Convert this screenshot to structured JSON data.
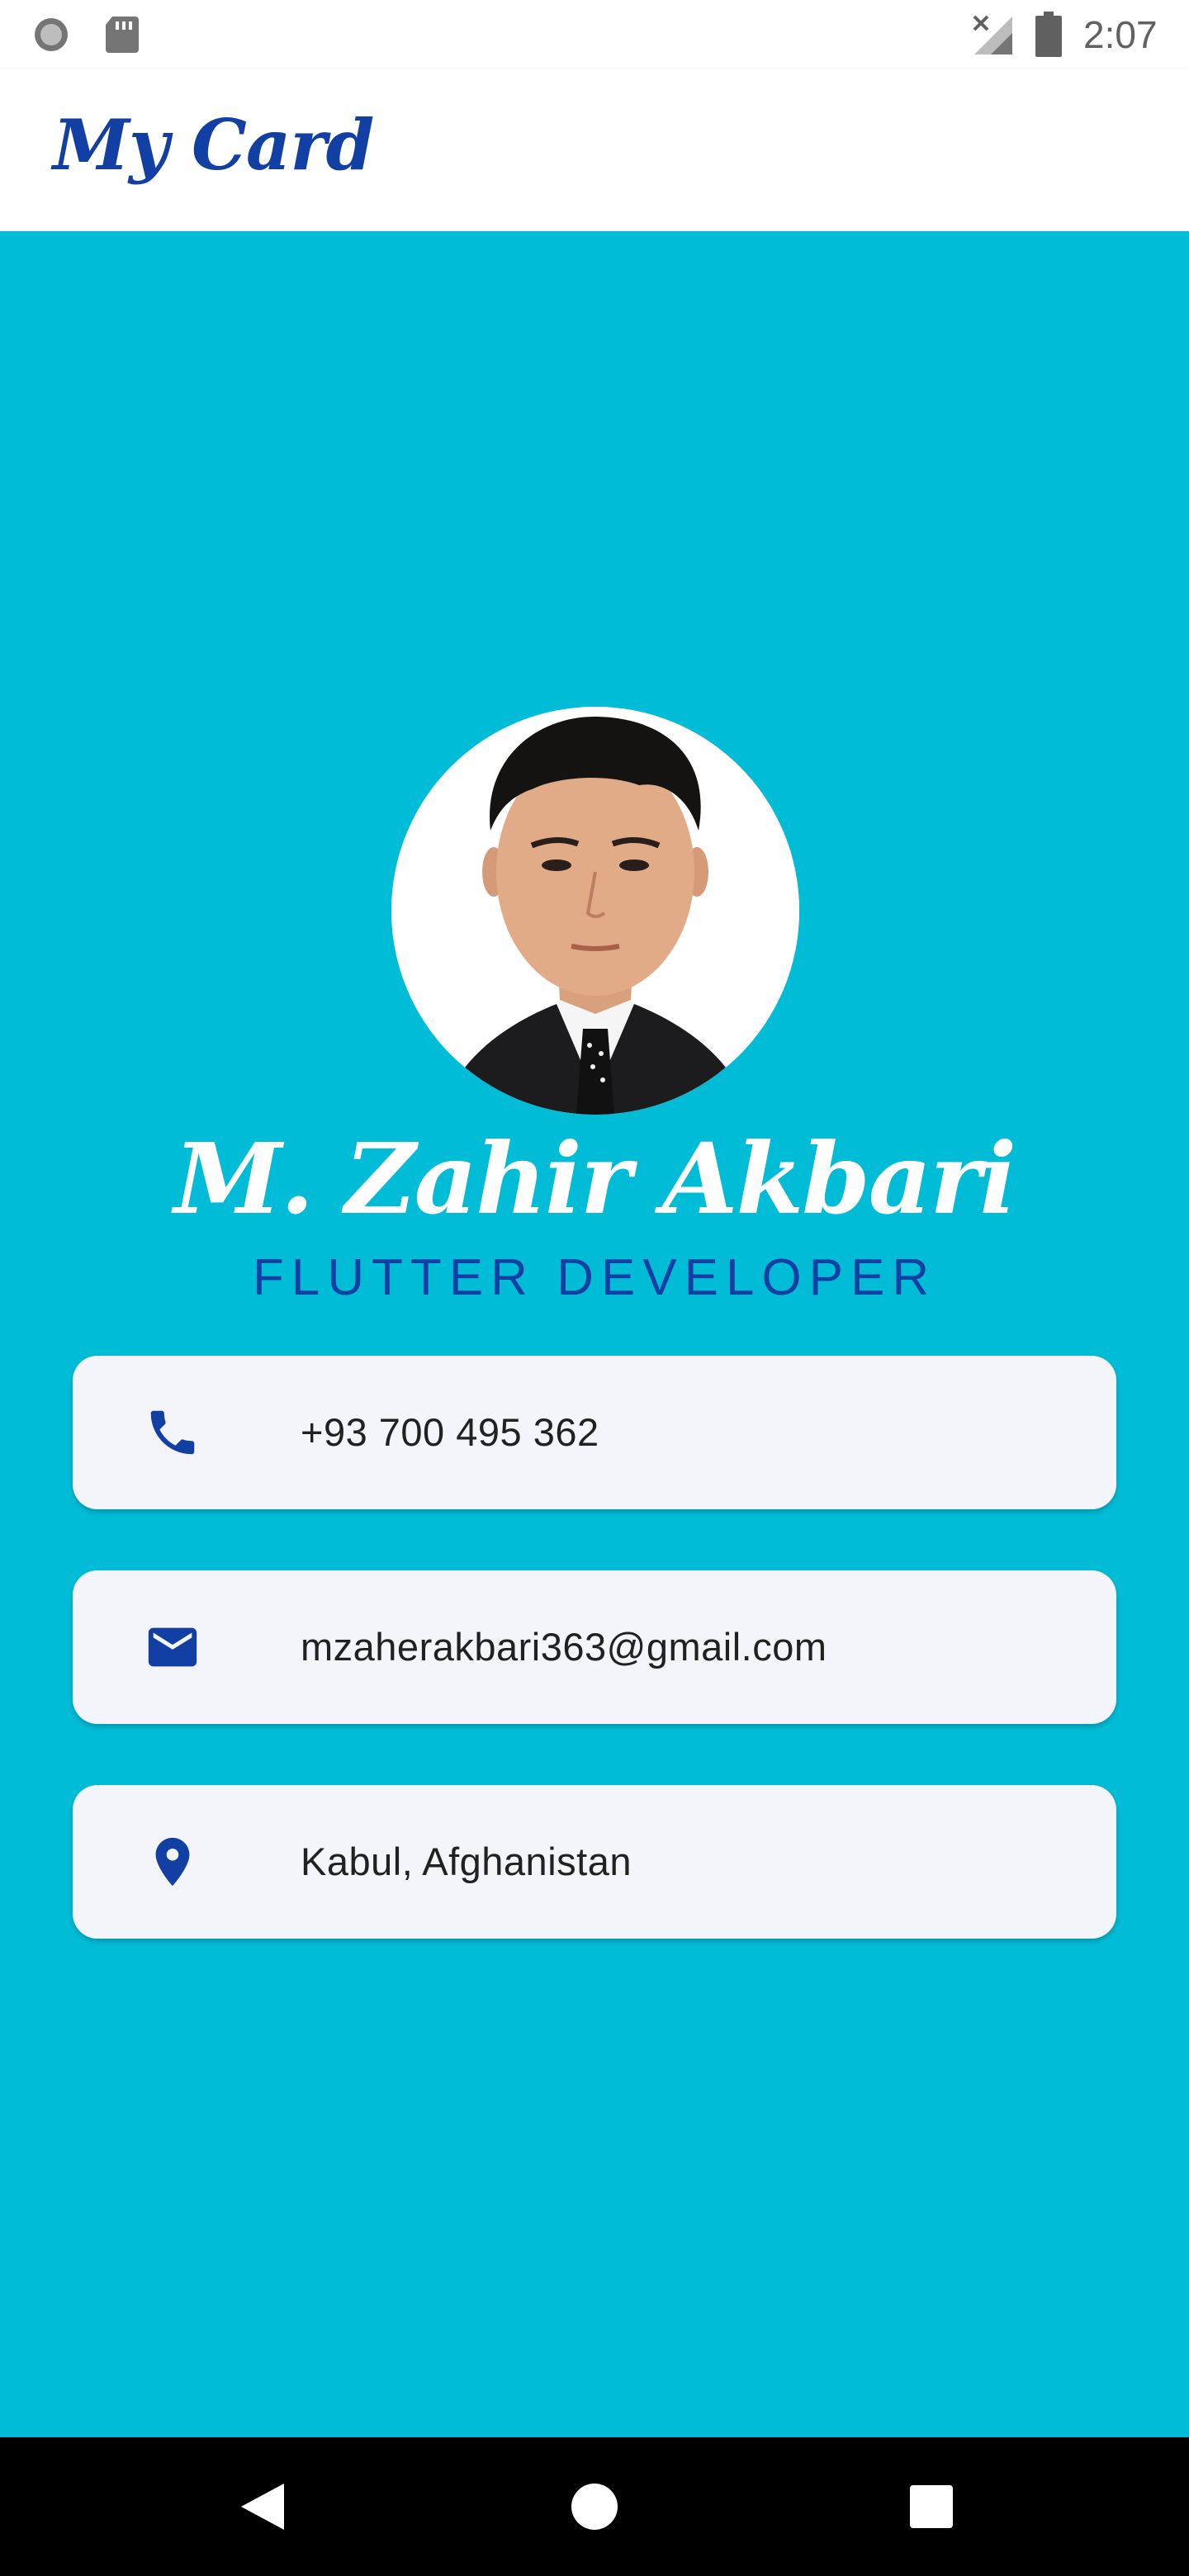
{
  "status_bar": {
    "time": "2:07",
    "icons": [
      "record-icon",
      "sd-card-icon",
      "signal-off-icon",
      "battery-icon"
    ]
  },
  "app_bar": {
    "title": "My Card",
    "title_color": "#123fa3"
  },
  "profile": {
    "name": "M. Zahir Akbari",
    "title": "FLUTTER DEVELOPER",
    "avatar_icon": "profile-photo"
  },
  "contacts": [
    {
      "icon": "phone-icon",
      "value": "+93 700 495 362"
    },
    {
      "icon": "email-icon",
      "value": "mzaherakbari363@gmail.com"
    },
    {
      "icon": "location-pin-icon",
      "value": "Kabul, Afghanistan"
    }
  ],
  "nav_bar": {
    "buttons": [
      "back-icon",
      "home-icon",
      "recents-icon"
    ]
  },
  "colors": {
    "background": "#00bcd6",
    "accent": "#123fa3",
    "card": "#f4f5fb"
  }
}
